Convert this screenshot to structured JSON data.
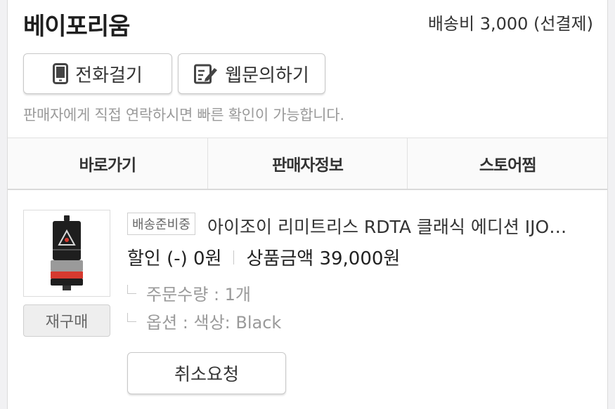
{
  "store": {
    "name": "베이포리움",
    "shipping": "배송비 3,000 (선결제)"
  },
  "contact": {
    "call_label": "전화걸기",
    "web_inquiry_label": "웹문의하기",
    "notice": "판매자에게 직접 연락하시면 빠른 확인이 가능합니다."
  },
  "tabs": [
    {
      "label": "바로가기"
    },
    {
      "label": "판매자정보"
    },
    {
      "label": "스토어찜"
    }
  ],
  "order_item": {
    "status_badge": "배송준비중",
    "product_name": "아이조이 리미트리스 RDTA 클래식 에디션 IJO…",
    "discount": "할인 (-) 0원",
    "amount": "상품금액 39,000원",
    "quantity": "주문수량 : 1개",
    "option": "옵션 : 색상: Black",
    "rebuy_label": "재구매",
    "cancel_label": "취소요청"
  },
  "colors": {
    "accent_red": "#d63a2f",
    "border": "#c8c8c8",
    "muted_text": "#9a9a9a"
  }
}
